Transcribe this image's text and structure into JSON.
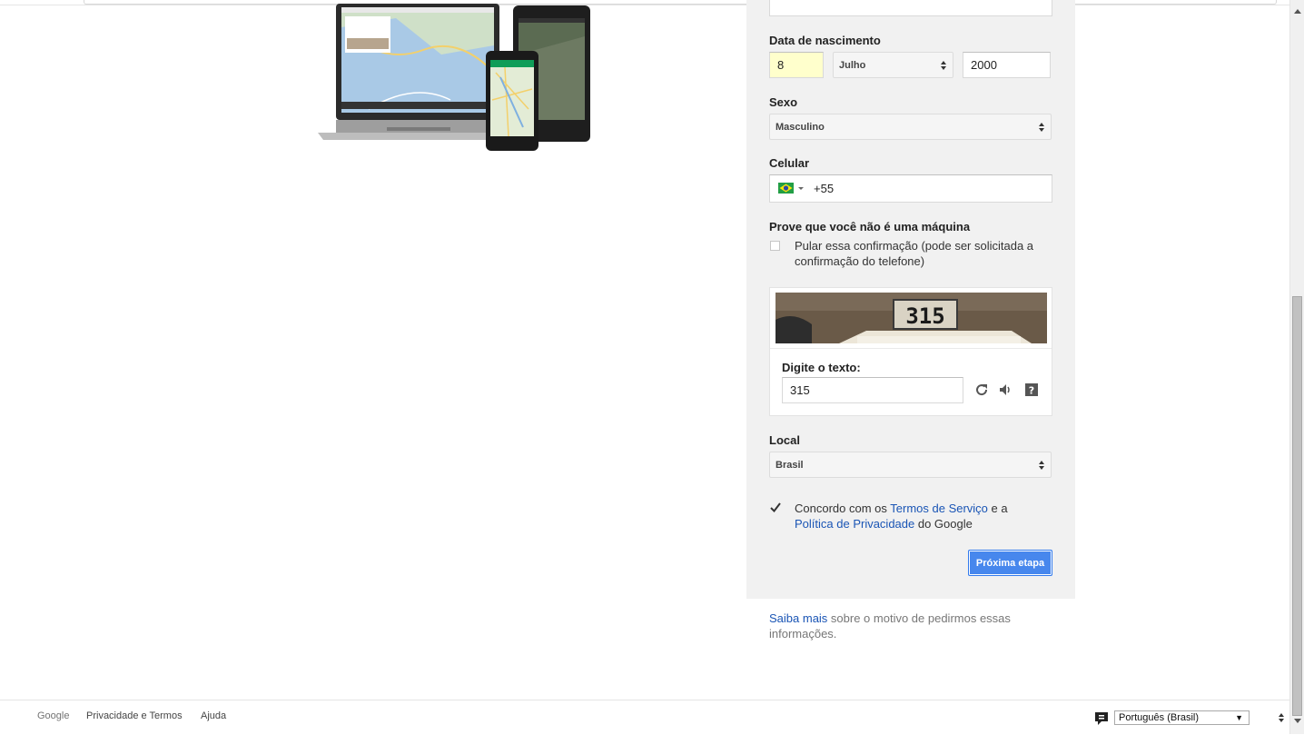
{
  "form": {
    "birthdate": {
      "label": "Data de nascimento",
      "day_value": "8",
      "month_value": "Julho",
      "year_value": "2000"
    },
    "gender": {
      "label": "Sexo",
      "value": "Masculino"
    },
    "mobile": {
      "label": "Celular",
      "country_icon": "brazil-flag-icon",
      "country_code": "+55"
    },
    "captcha_section": {
      "label": "Prove que você não é uma máquina",
      "skip_checked": false,
      "skip_text_line1": "Pular essa confirmação (pode ser solicitada a",
      "skip_text_line2": "confirmação do telefone)",
      "image_text": "315",
      "input_label": "Digite o texto:",
      "input_value": "315",
      "icons": [
        "refresh-icon",
        "audio-icon",
        "help-icon"
      ]
    },
    "location": {
      "label": "Local",
      "value": "Brasil"
    },
    "terms": {
      "checked": true,
      "text_before": "Concordo com os ",
      "terms_link": "Termos de Serviço",
      "text_middle": " e a",
      "privacy_link": "Política de Privacidade",
      "text_after": " do Google"
    },
    "next_button": "Próxima etapa"
  },
  "info": {
    "link": "Saiba mais",
    "text_line1": " sobre o motivo de pedirmos essas",
    "text_line2": "informações."
  },
  "footer": {
    "brand": "Google",
    "privacy_terms": "Privacidade e Termos",
    "help": "Ajuda",
    "language_selected": "Português (Brasil)"
  },
  "colors": {
    "panel_bg": "#f1f1f1",
    "accent_blue": "#4787ed",
    "link_blue": "#1a55b5",
    "highlight_yellow": "#ffffcc"
  }
}
